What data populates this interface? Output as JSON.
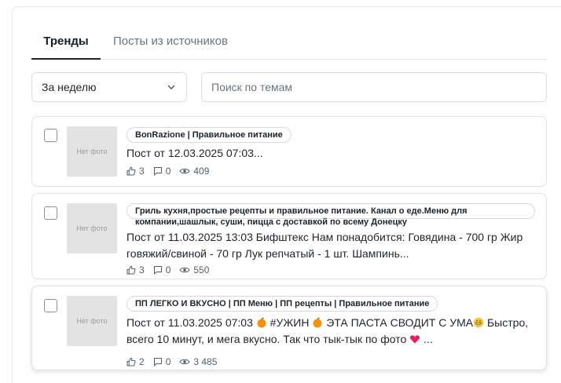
{
  "tabs": [
    {
      "label": "Тренды",
      "active": true
    },
    {
      "label": "Посты из источников",
      "active": false
    }
  ],
  "period_select": {
    "value": "За неделю"
  },
  "search": {
    "placeholder": "Поиск по темам",
    "value": ""
  },
  "posts": [
    {
      "thumb_text": "Нет фото",
      "source": "BonRazione | Правильное питание",
      "title": "Пост от 12.03.2025 07:03...",
      "likes": "3",
      "comments": "0",
      "views": "409"
    },
    {
      "thumb_text": "Нет фото",
      "source": "Гриль кухня,простые рецепты и правильное питание. Канал о еде.Меню для компании,шашлык, суши, пицца с доставкой по всему Донецку",
      "title": "Пост от 11.03.2025 13:03 Бифштекс Нам понадобится: Говядина - 700 гр Жир говяжий/свиной - 70 гр Лук репчатый - 1 шт. Шампинь...",
      "likes": "3",
      "comments": "0",
      "views": "550"
    },
    {
      "thumb_text": "Нет фото",
      "source": "ПП ЛЕГКО И ВКУСНО | ПП Меню | ПП рецепты | Правильное питание",
      "title_parts": {
        "a": "Пост от 11.03.2025 07:03 ",
        "b": " #УЖИН ",
        "c": "  ЭТА ПАСТА СВОДИТ С УМА",
        "d": " Быстро, всего 10 минут, и мега вкусно. Так что тык-тык по фото ",
        "e": " ..."
      },
      "likes": "2",
      "comments": "0",
      "views": "3 485"
    }
  ],
  "colors": {
    "accent": "#1f2328",
    "muted": "#6b7280",
    "thumb_bg": "#e3e3e3",
    "heart": "#e0245e",
    "orange": "#f4900c"
  }
}
